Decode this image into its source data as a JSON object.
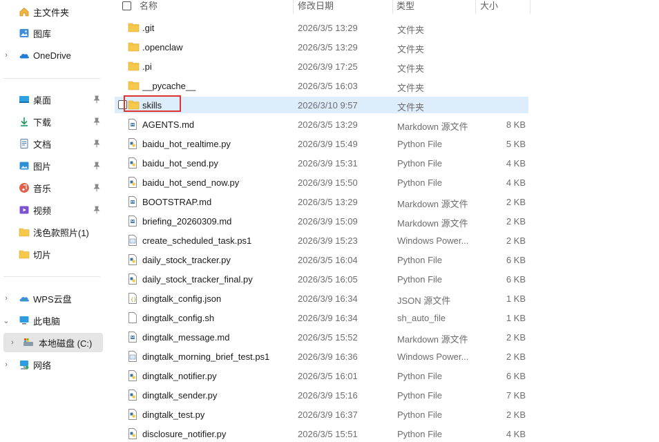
{
  "sidebar": {
    "items": [
      {
        "label": "主文件夹",
        "icon": "home-icon"
      },
      {
        "label": "图库",
        "icon": "gallery-icon"
      },
      {
        "label": "OneDrive",
        "icon": "onedrive-cloud-icon"
      },
      {
        "label": "桌面",
        "icon": "desktop-icon"
      },
      {
        "label": "下载",
        "icon": "download-icon"
      },
      {
        "label": "文档",
        "icon": "documents-icon"
      },
      {
        "label": "图片",
        "icon": "pictures-icon"
      },
      {
        "label": "音乐",
        "icon": "music-icon"
      },
      {
        "label": "视频",
        "icon": "videos-icon"
      },
      {
        "label": "浅色款照片(1)",
        "icon": "folder-icon"
      },
      {
        "label": "切片",
        "icon": "folder-icon"
      },
      {
        "label": "WPS云盘",
        "icon": "wps-cloud-icon"
      },
      {
        "label": "此电脑",
        "icon": "this-pc-icon"
      },
      {
        "label": "本地磁盘 (C:)",
        "icon": "local-disk-icon"
      },
      {
        "label": "网络",
        "icon": "network-icon"
      }
    ]
  },
  "columns": {
    "name": "名称",
    "date": "修改日期",
    "type": "类型",
    "size": "大小"
  },
  "files": [
    {
      "name": ".git",
      "date": "2026/3/5 13:29",
      "type": "文件夹",
      "size": "",
      "kind": "folder"
    },
    {
      "name": ".openclaw",
      "date": "2026/3/5 13:29",
      "type": "文件夹",
      "size": "",
      "kind": "folder"
    },
    {
      "name": ".pi",
      "date": "2026/3/9 17:25",
      "type": "文件夹",
      "size": "",
      "kind": "folder"
    },
    {
      "name": "__pycache__",
      "date": "2026/3/5 16:03",
      "type": "文件夹",
      "size": "",
      "kind": "folder"
    },
    {
      "name": "skills",
      "date": "2026/3/10 9:57",
      "type": "文件夹",
      "size": "",
      "kind": "folder"
    },
    {
      "name": "AGENTS.md",
      "date": "2026/3/5 13:29",
      "type": "Markdown 源文件",
      "size": "8 KB",
      "kind": "md"
    },
    {
      "name": "baidu_hot_realtime.py",
      "date": "2026/3/9 15:49",
      "type": "Python File",
      "size": "5 KB",
      "kind": "py"
    },
    {
      "name": "baidu_hot_send.py",
      "date": "2026/3/9 15:31",
      "type": "Python File",
      "size": "4 KB",
      "kind": "py"
    },
    {
      "name": "baidu_hot_send_now.py",
      "date": "2026/3/9 15:50",
      "type": "Python File",
      "size": "4 KB",
      "kind": "py"
    },
    {
      "name": "BOOTSTRAP.md",
      "date": "2026/3/5 13:29",
      "type": "Markdown 源文件",
      "size": "2 KB",
      "kind": "md"
    },
    {
      "name": "briefing_20260309.md",
      "date": "2026/3/9 15:09",
      "type": "Markdown 源文件",
      "size": "2 KB",
      "kind": "md"
    },
    {
      "name": "create_scheduled_task.ps1",
      "date": "2026/3/9 15:23",
      "type": "Windows Power...",
      "size": "2 KB",
      "kind": "ps1"
    },
    {
      "name": "daily_stock_tracker.py",
      "date": "2026/3/5 16:04",
      "type": "Python File",
      "size": "6 KB",
      "kind": "py"
    },
    {
      "name": "daily_stock_tracker_final.py",
      "date": "2026/3/5 16:05",
      "type": "Python File",
      "size": "6 KB",
      "kind": "py"
    },
    {
      "name": "dingtalk_config.json",
      "date": "2026/3/9 16:34",
      "type": "JSON 源文件",
      "size": "1 KB",
      "kind": "json"
    },
    {
      "name": "dingtalk_config.sh",
      "date": "2026/3/9 16:34",
      "type": "sh_auto_file",
      "size": "1 KB",
      "kind": "blank"
    },
    {
      "name": "dingtalk_message.md",
      "date": "2026/3/5 15:52",
      "type": "Markdown 源文件",
      "size": "2 KB",
      "kind": "md"
    },
    {
      "name": "dingtalk_morning_brief_test.ps1",
      "date": "2026/3/9 16:36",
      "type": "Windows Power...",
      "size": "2 KB",
      "kind": "ps1"
    },
    {
      "name": "dingtalk_notifier.py",
      "date": "2026/3/5 16:01",
      "type": "Python File",
      "size": "6 KB",
      "kind": "py"
    },
    {
      "name": "dingtalk_sender.py",
      "date": "2026/3/9 15:16",
      "type": "Python File",
      "size": "7 KB",
      "kind": "py"
    },
    {
      "name": "dingtalk_test.py",
      "date": "2026/3/9 16:37",
      "type": "Python File",
      "size": "2 KB",
      "kind": "py"
    },
    {
      "name": "disclosure_notifier.py",
      "date": "2026/3/5 15:51",
      "type": "Python File",
      "size": "4 KB",
      "kind": "py"
    }
  ],
  "colors": {
    "selection": "#ddedfc",
    "highlight_box": "#e0302f",
    "folder": "#f6c94c"
  }
}
